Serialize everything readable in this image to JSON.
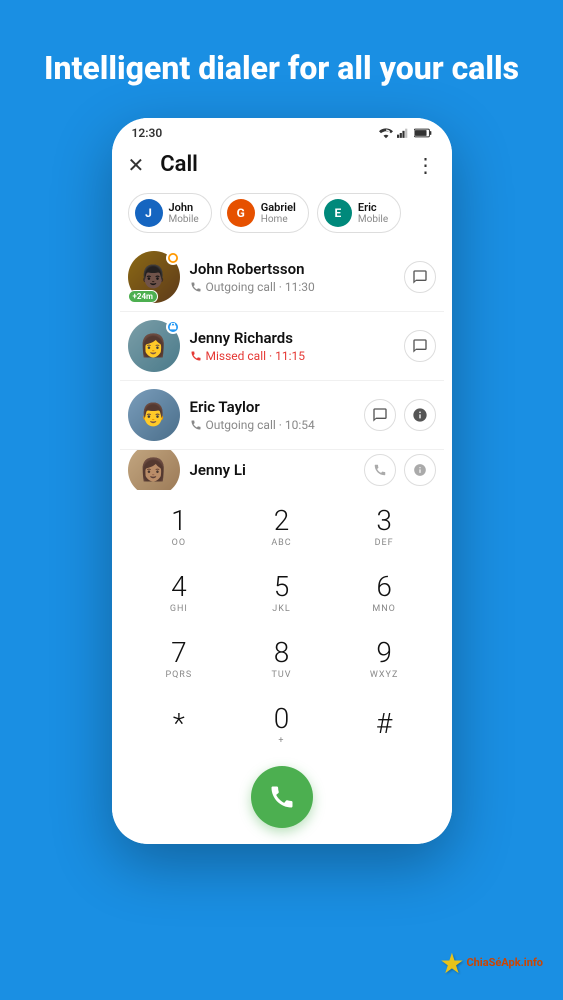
{
  "hero": {
    "title": "Intelligent dialer for all your calls"
  },
  "phone": {
    "statusBar": {
      "time": "12:30",
      "icons": [
        "wifi",
        "signal",
        "battery"
      ]
    },
    "header": {
      "closeLabel": "✕",
      "title": "Call",
      "moreLabel": "⋮"
    },
    "quickContacts": [
      {
        "id": "john-chip",
        "initial": "J",
        "name": "John",
        "type": "Mobile",
        "color": "#1565C0"
      },
      {
        "id": "gabriel-chip",
        "initial": "G",
        "name": "Gabriel",
        "type": "Home",
        "color": "#E65100"
      },
      {
        "id": "eric-chip",
        "initial": "E",
        "name": "Eric",
        "type": "Mobile",
        "color": "#00897B"
      }
    ],
    "calls": [
      {
        "id": "call-john",
        "name": "John Robertsson",
        "detail": "Outgoing call · 11:30",
        "type": "outgoing",
        "badge": "+24m",
        "hasOnlineBadge": true,
        "onlineBadgeColor": "#FF9800"
      },
      {
        "id": "call-jenny",
        "name": "Jenny Richards",
        "detail": "Missed call · 11:15",
        "type": "missed",
        "badge": "",
        "hasOnlineBadge": true,
        "onlineBadgeColor": "#2196F3"
      },
      {
        "id": "call-eric",
        "name": "Eric Taylor",
        "detail": "Outgoing call · 10:54",
        "type": "outgoing",
        "badge": "",
        "hasOnlineBadge": false,
        "onlineBadgeColor": ""
      },
      {
        "id": "call-jennyLi",
        "name": "Jenny Li",
        "detail": "",
        "type": "partial",
        "badge": "",
        "hasOnlineBadge": false,
        "onlineBadgeColor": ""
      }
    ],
    "dialpad": {
      "rows": [
        [
          {
            "num": "1",
            "letters": "OO"
          },
          {
            "num": "2",
            "letters": "ABC"
          },
          {
            "num": "3",
            "letters": "DEF"
          }
        ],
        [
          {
            "num": "4",
            "letters": "GHI"
          },
          {
            "num": "5",
            "letters": "JKL"
          },
          {
            "num": "6",
            "letters": "MNO"
          }
        ],
        [
          {
            "num": "7",
            "letters": "PQRS"
          },
          {
            "num": "8",
            "letters": "TUV"
          },
          {
            "num": "9",
            "letters": "WXYZ"
          }
        ],
        [
          {
            "num": "*",
            "letters": ""
          },
          {
            "num": "0",
            "letters": "+"
          },
          {
            "num": "#",
            "letters": ""
          }
        ]
      ]
    },
    "callButton": {
      "label": "📞"
    }
  },
  "watermark": {
    "starLabel": "★",
    "text": "ChiaSéApk.info"
  }
}
